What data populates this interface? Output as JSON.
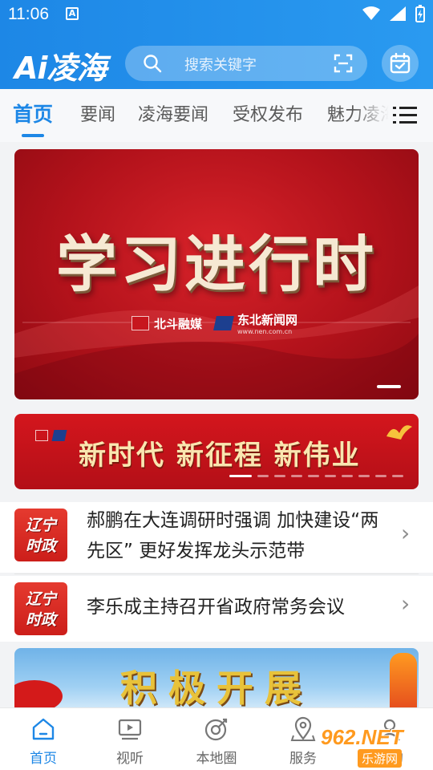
{
  "status_bar": {
    "time": "11:06",
    "notification_icon": "A"
  },
  "header": {
    "logo": "Ai凌海",
    "search": {
      "placeholder": "搜索关键字"
    },
    "icons": [
      "search-icon",
      "scan-icon",
      "calendar-icon"
    ]
  },
  "tabs": {
    "items": [
      {
        "label": "首页",
        "active": true
      },
      {
        "label": "要闻",
        "active": false
      },
      {
        "label": "凌海要闻",
        "active": false
      },
      {
        "label": "受权发布",
        "active": false
      },
      {
        "label": "魅力凌海",
        "active": false
      }
    ]
  },
  "banner": {
    "title": "学习进行时",
    "source1": "北斗融媒",
    "source2": "东北新闻网",
    "source2_url": "www.nen.com.cn",
    "dot_count": 1
  },
  "banner2": {
    "text": "新时代 新征程 新伟业",
    "pager": {
      "total": 10,
      "active": 0
    }
  },
  "news": [
    {
      "thumb_line1": "辽宁",
      "thumb_line2": "时政",
      "title": "郝鹏在大连调研时强调 加快建设“两先区” 更好发挥龙头示范带"
    },
    {
      "thumb_line1": "辽宁",
      "thumb_line2": "时政",
      "title": "李乐成主持召开省政府常务会议"
    }
  ],
  "banner3": {
    "text": "积极开展"
  },
  "bottom_nav": {
    "items": [
      {
        "label": "首页",
        "icon": "home-icon",
        "active": true
      },
      {
        "label": "视听",
        "icon": "video-icon",
        "active": false
      },
      {
        "label": "本地圈",
        "icon": "local-circle-icon",
        "active": false
      },
      {
        "label": "服务",
        "icon": "location-pin-icon",
        "active": false
      },
      {
        "label": "我的",
        "icon": "user-icon",
        "active": false
      }
    ]
  },
  "watermark": {
    "number": "962.NET",
    "sub": "乐游网"
  },
  "colors": {
    "primary": "#1d87e6",
    "banner_red": "#c41820",
    "text": "#222222"
  }
}
